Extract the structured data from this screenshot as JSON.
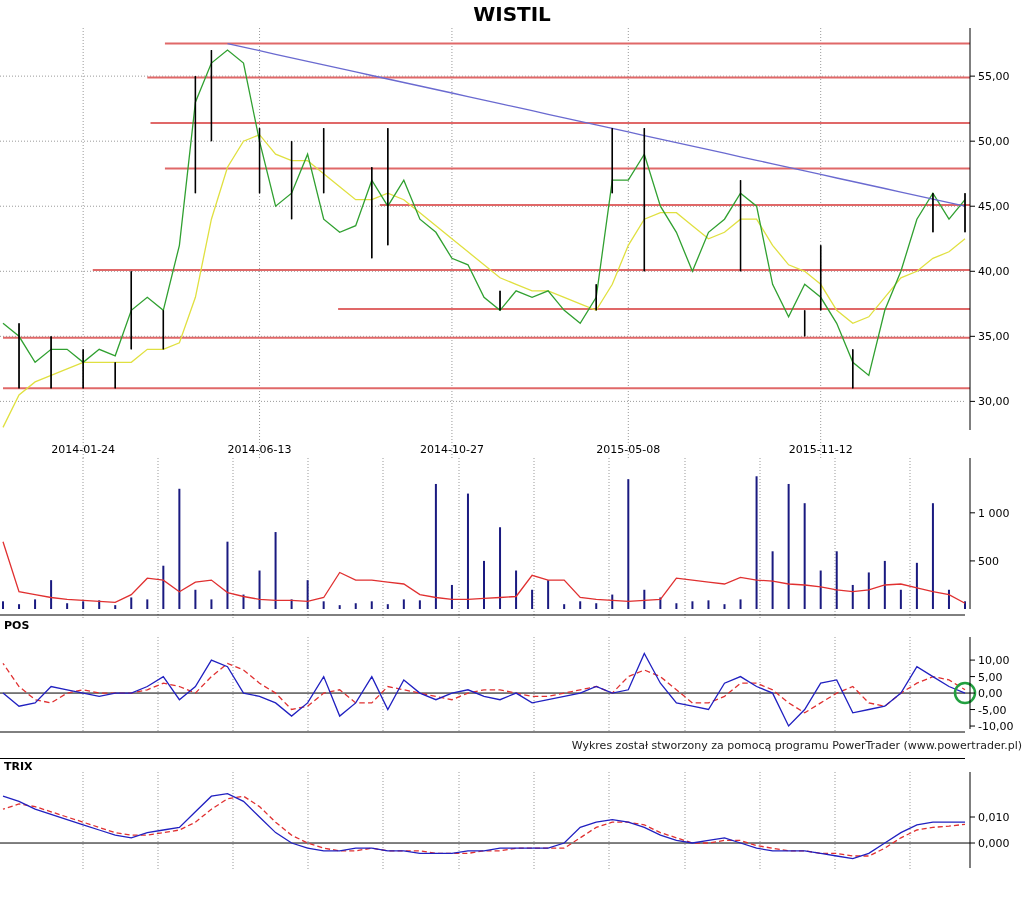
{
  "price_chart": {
    "chart_data": {
      "type": "line",
      "title": "WISTIL",
      "grid": true,
      "categories": [
        null,
        null,
        null,
        null,
        null,
        "2014-01-24",
        null,
        null,
        null,
        null,
        null,
        null,
        null,
        null,
        null,
        null,
        "2014-06-13",
        null,
        null,
        null,
        null,
        null,
        null,
        null,
        null,
        null,
        null,
        null,
        "2014-10-27",
        null,
        null,
        null,
        null,
        null,
        null,
        null,
        null,
        null,
        null,
        "2015-05-08",
        null,
        null,
        null,
        null,
        null,
        null,
        null,
        null,
        null,
        null,
        null,
        "2015-11-12",
        null,
        null,
        null,
        null,
        null,
        null,
        null,
        null,
        null
      ],
      "ylim": [
        27.8,
        58.7
      ],
      "yticks": [
        {
          "value": 30,
          "label": "30,00"
        },
        {
          "value": 35,
          "label": "35,00"
        },
        {
          "value": 40,
          "label": "40,00"
        },
        {
          "value": 45,
          "label": "45,00"
        },
        {
          "value": 50,
          "label": "50,00"
        },
        {
          "value": 55,
          "label": "55,00"
        }
      ],
      "series": [
        {
          "color": "#e0e040",
          "values": [
            28,
            30.5,
            31.5,
            32,
            32.5,
            33,
            33,
            33,
            33,
            34,
            34,
            34.5,
            38,
            44,
            48,
            50,
            50.5,
            49,
            48.5,
            48.5,
            47.5,
            46.5,
            45.5,
            45.5,
            46,
            45.5,
            44.5,
            43.5,
            42.5,
            41.5,
            40.5,
            39.5,
            39,
            38.5,
            38.5,
            38,
            37.5,
            37,
            39,
            42,
            44,
            44.5,
            44.5,
            43.5,
            42.5,
            43,
            44,
            44,
            42,
            40.5,
            40,
            39,
            37,
            36,
            36.5,
            38,
            39.5,
            40,
            41,
            41.5,
            42.5
          ]
        },
        {
          "color": "#30a030",
          "values": [
            36,
            35,
            33,
            34,
            34,
            33,
            34,
            33.5,
            37,
            38,
            37,
            42,
            53,
            56,
            57,
            56,
            50,
            45,
            46,
            49,
            44,
            43,
            43.5,
            47,
            45,
            47,
            44,
            43,
            41,
            40.5,
            38,
            37,
            38.5,
            38,
            38.5,
            37,
            36,
            38,
            47,
            47,
            49,
            45,
            43,
            40,
            43,
            44,
            46,
            45,
            39,
            36.5,
            39,
            38,
            36,
            33,
            32,
            37,
            40,
            44,
            46,
            44,
            45.5
          ]
        },
        {
          "color": "#6a6ad0",
          "values": [
            null,
            null,
            null,
            null,
            null,
            null,
            null,
            null,
            null,
            null,
            null,
            null,
            null,
            null,
            57.5,
            57.23,
            56.96,
            56.68,
            56.41,
            56.14,
            55.87,
            55.6,
            55.33,
            55.05,
            54.78,
            54.51,
            54.24,
            53.97,
            53.7,
            53.42,
            53.15,
            52.88,
            52.61,
            52.34,
            52.07,
            51.79,
            51.52,
            51.25,
            50.98,
            50.71,
            50.43,
            50.16,
            49.89,
            49.62,
            49.35,
            49.08,
            48.8,
            48.53,
            48.26,
            47.99,
            47.72,
            47.45,
            47.17,
            46.9,
            46.63,
            46.36,
            46.09,
            45.82,
            45.54,
            45.27,
            45
          ]
        },
        {
          "type": "candlestick",
          "color": "#000000",
          "ohlc": [
            null,
            [
              31,
              36,
              31,
              36
            ],
            null,
            [
              31,
              35,
              31,
              35
            ],
            null,
            [
              31,
              34,
              31,
              34
            ],
            null,
            [
              31,
              33,
              31,
              33
            ],
            [
              34,
              40,
              34,
              40
            ],
            null,
            [
              34,
              37,
              34,
              37
            ],
            null,
            [
              46,
              55,
              46,
              55
            ],
            [
              50,
              57,
              50,
              57
            ],
            null,
            null,
            [
              46,
              51,
              46,
              51
            ],
            null,
            [
              44,
              50,
              44,
              50
            ],
            null,
            [
              46,
              51,
              46,
              51
            ],
            null,
            null,
            [
              41,
              48,
              41,
              48
            ],
            [
              42,
              51,
              42,
              51
            ],
            null,
            null,
            null,
            null,
            null,
            null,
            [
              37,
              38.5,
              37,
              38.5
            ],
            null,
            null,
            null,
            null,
            null,
            [
              37,
              39,
              37,
              39
            ],
            [
              46,
              51,
              46,
              51
            ],
            null,
            [
              40,
              51,
              40,
              51
            ],
            null,
            null,
            null,
            null,
            null,
            [
              40,
              47,
              40,
              47
            ],
            null,
            null,
            null,
            [
              35,
              37,
              35,
              37
            ],
            [
              37,
              42,
              37,
              42
            ],
            null,
            [
              31,
              34,
              31,
              34
            ],
            null,
            null,
            null,
            null,
            [
              43,
              46,
              43,
              46
            ],
            null,
            [
              43,
              46,
              43,
              46
            ]
          ]
        }
      ],
      "ref_lines": [
        {
          "axis": "y",
          "value": 57.5,
          "color": "#e06868"
        },
        {
          "axis": "y",
          "value": 54.9,
          "color": "#e06868"
        },
        {
          "axis": "y",
          "value": 51.4,
          "color": "#e06868"
        },
        {
          "axis": "y",
          "value": 47.9,
          "color": "#e06868"
        },
        {
          "axis": "y",
          "value": 45.1,
          "color": "#e06868"
        },
        {
          "axis": "y",
          "value": 40.1,
          "color": "#e06868"
        },
        {
          "axis": "y",
          "value": 37.1,
          "color": "#e06868"
        },
        {
          "axis": "y",
          "value": 34.9,
          "color": "#e06868"
        },
        {
          "axis": "y",
          "value": 31,
          "color": "#e06868"
        }
      ]
    }
  },
  "volume_chart": {
    "chart_data": {
      "type": "bar",
      "grid": true,
      "ylim": [
        0,
        1570
      ],
      "yticks": [
        {
          "value": 500,
          "label": "500"
        },
        {
          "value": 1000,
          "label": "1 000"
        }
      ],
      "series": [
        {
          "color": "#1a1a80",
          "values": [
            80,
            50,
            100,
            300,
            60,
            80,
            90,
            40,
            120,
            100,
            450,
            1250,
            200,
            100,
            700,
            150,
            400,
            800,
            100,
            300,
            80,
            40,
            60,
            80,
            50,
            100,
            90,
            1300,
            250,
            1200,
            500,
            850,
            400,
            200,
            300,
            50,
            80,
            60,
            150,
            1350,
            200,
            120,
            60,
            80,
            90,
            50,
            100,
            1380,
            600,
            1300,
            1100,
            400,
            600,
            250,
            380,
            500,
            200,
            480,
            1100,
            200,
            80
          ]
        },
        {
          "type": "line",
          "color": "#e03030",
          "values": [
            700,
            180,
            150,
            120,
            100,
            90,
            80,
            70,
            150,
            320,
            300,
            180,
            280,
            300,
            170,
            130,
            100,
            90,
            90,
            80,
            120,
            380,
            300,
            300,
            280,
            260,
            150,
            120,
            100,
            100,
            110,
            120,
            130,
            350,
            300,
            300,
            120,
            100,
            90,
            80,
            90,
            100,
            320,
            300,
            280,
            260,
            330,
            300,
            290,
            260,
            250,
            230,
            200,
            180,
            200,
            250,
            260,
            220,
            180,
            150,
            60
          ]
        }
      ]
    }
  },
  "pos_chart": {
    "chart_data": {
      "type": "line",
      "title": "POS",
      "grid": true,
      "ylim": [
        -10.9,
        17
      ],
      "yticks": [
        {
          "value": 10,
          "label": "10,00"
        },
        {
          "value": 5,
          "label": "5,00"
        },
        {
          "value": 0,
          "label": "0,00"
        },
        {
          "value": -5,
          "label": "-5,00"
        },
        {
          "value": -10,
          "label": "-10,00"
        }
      ],
      "series": [
        {
          "line_style": "dashed",
          "color": "#e03030",
          "values": [
            9,
            2,
            -2,
            -3,
            0,
            1,
            0,
            0,
            0,
            1,
            3,
            2,
            0,
            5,
            9,
            7,
            3,
            0,
            -5,
            -4,
            0,
            1,
            -3,
            -3,
            2,
            1,
            0,
            -1,
            -2,
            0,
            1,
            1,
            0,
            -1,
            -1,
            0,
            1,
            2,
            0,
            5,
            7,
            5,
            1,
            -3,
            -3,
            -1,
            3,
            3,
            1,
            -3,
            -6,
            -3,
            0,
            2,
            -3,
            -4,
            0,
            3,
            5,
            4,
            1
          ]
        },
        {
          "color": "#2020c0",
          "values": [
            0,
            -4,
            -3,
            2,
            1,
            0,
            -1,
            0,
            0,
            2,
            5,
            -2,
            2,
            10,
            8,
            0,
            -1,
            -3,
            -7,
            -3,
            5,
            -7,
            -3,
            5,
            -5,
            4,
            0,
            -2,
            0,
            1,
            -1,
            -2,
            0,
            -3,
            -2,
            -1,
            0,
            2,
            0,
            1,
            12,
            3,
            -3,
            -4,
            -5,
            3,
            5,
            2,
            0,
            -10,
            -5,
            3,
            4,
            -6,
            -5,
            -4,
            0,
            8,
            5,
            2,
            0
          ]
        }
      ]
    }
  },
  "credit": "Wykres został stworzony za pomocą programu PowerTrader (www.powertrader.pl)",
  "trix_chart": {
    "chart_data": {
      "type": "line",
      "title": "TRIX",
      "grid": true,
      "ylim": [
        -0.0096,
        0.0273
      ],
      "yticks": [
        {
          "value": 0.01,
          "label": "0,010"
        },
        {
          "value": 0,
          "label": "0,000"
        }
      ],
      "series": [
        {
          "line_style": "dashed",
          "color": "#e03030",
          "values": [
            0.013,
            0.015,
            0.014,
            0.012,
            0.01,
            0.008,
            0.006,
            0.004,
            0.003,
            0.003,
            0.004,
            0.005,
            0.008,
            0.013,
            0.017,
            0.018,
            0.014,
            0.008,
            0.003,
            0.0,
            -0.002,
            -0.003,
            -0.003,
            -0.002,
            -0.003,
            -0.003,
            -0.003,
            -0.004,
            -0.004,
            -0.004,
            -0.003,
            -0.003,
            -0.002,
            -0.002,
            -0.002,
            -0.002,
            0.002,
            0.006,
            0.008,
            0.008,
            0.007,
            0.004,
            0.002,
            0.0,
            0.0,
            0.001,
            0.001,
            -0.001,
            -0.002,
            -0.003,
            -0.003,
            -0.004,
            -0.004,
            -0.005,
            -0.005,
            -0.002,
            0.002,
            0.005,
            0.006,
            0.0065,
            0.0072
          ]
        },
        {
          "color": "#2020c0",
          "values": [
            0.018,
            0.016,
            0.013,
            0.011,
            0.009,
            0.007,
            0.005,
            0.003,
            0.002,
            0.004,
            0.005,
            0.006,
            0.012,
            0.018,
            0.019,
            0.016,
            0.01,
            0.004,
            0.0,
            -0.002,
            -0.003,
            -0.003,
            -0.002,
            -0.002,
            -0.003,
            -0.003,
            -0.004,
            -0.004,
            -0.004,
            -0.003,
            -0.003,
            -0.002,
            -0.002,
            -0.002,
            -0.002,
            0.0,
            0.006,
            0.008,
            0.009,
            0.008,
            0.006,
            0.003,
            0.001,
            0.0,
            0.001,
            0.002,
            0.0,
            -0.002,
            -0.003,
            -0.003,
            -0.003,
            -0.004,
            -0.005,
            -0.006,
            -0.004,
            0.0,
            0.004,
            0.007,
            0.008,
            0.008,
            0.008
          ]
        }
      ]
    }
  }
}
